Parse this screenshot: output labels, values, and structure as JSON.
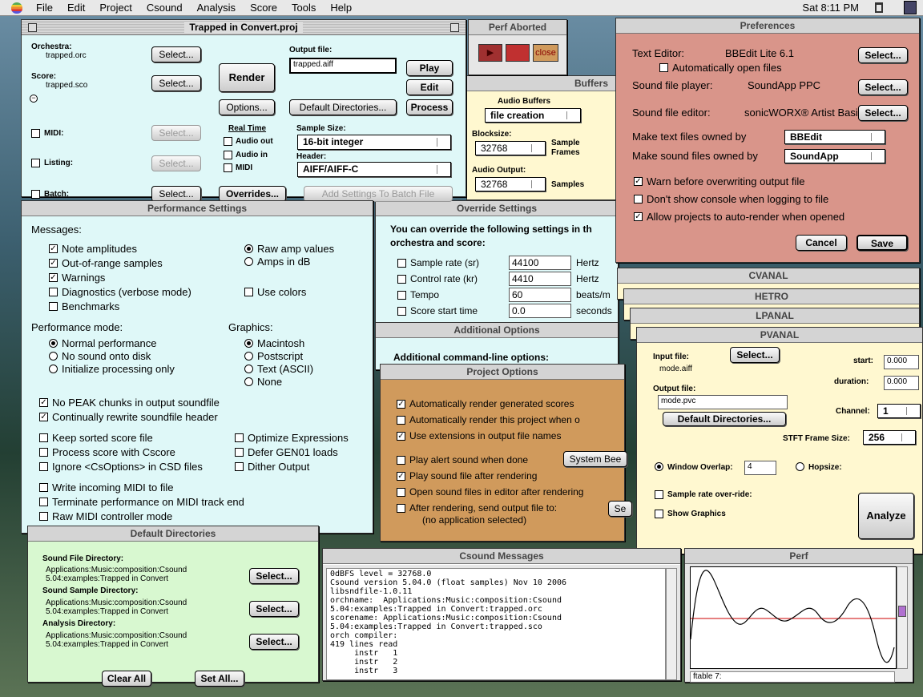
{
  "menubar": {
    "items": [
      "File",
      "Edit",
      "Project",
      "Csound",
      "Analysis",
      "Score",
      "Tools",
      "Help"
    ],
    "clock": "Sat 8:11 PM"
  },
  "project": {
    "title": "Trapped in Convert.proj",
    "orchestra_label": "Orchestra:",
    "orchestra_file": "trapped.orc",
    "score_label": "Score:",
    "score_file": "trapped.sco",
    "select": "Select...",
    "render": "Render",
    "options": "Options...",
    "output_label": "Output file:",
    "output_value": "trapped.aiff",
    "play": "Play",
    "edit": "Edit",
    "default_dirs": "Default Directories...",
    "process": "Process",
    "midi": "MIDI:",
    "listing": "Listing:",
    "batch": "Batch:",
    "real_time": "Real Time",
    "audio_out": "Audio out",
    "audio_in": "Audio in",
    "rt_midi": "MIDI",
    "sample_size_label": "Sample Size:",
    "sample_size": "16-bit integer",
    "header_label": "Header:",
    "header": "AIFF/AIFF-C",
    "overrides": "Overrides...",
    "add_batch": "Add Settings To Batch File"
  },
  "perf_aborted": {
    "title": "Perf Aborted",
    "close": "close"
  },
  "buffers": {
    "title": "Buffers",
    "audio_buffers": "Audio Buffers",
    "mode": "file creation",
    "blocksize_label": "Blocksize:",
    "blocksize": "32768",
    "sample_frames": "Sample Frames",
    "audio_output_label": "Audio Output:",
    "audio_output": "32768",
    "samples": "Samples"
  },
  "prefs": {
    "title": "Preferences",
    "text_editor_label": "Text Editor:",
    "text_editor": "BBEdit Lite 6.1",
    "auto_open": "Automatically open files",
    "player_label": "Sound file player:",
    "player": "SoundApp PPC",
    "sfeditor_label": "Sound file editor:",
    "sfeditor": "sonicWORX® Artist Basic",
    "select": "Select...",
    "text_owned_label": "Make text files owned by",
    "text_owned": "BBEdit",
    "sound_owned_label": "Make sound files owned by",
    "sound_owned": "SoundApp",
    "warn": "Warn before overwriting output file",
    "no_console": "Don't show console when logging to file",
    "auto_render": "Allow projects to auto-render when opened",
    "cancel": "Cancel",
    "save": "Save"
  },
  "perfset": {
    "title": "Performance Settings",
    "messages": "Messages:",
    "note_amps": "Note amplitudes",
    "out_of_range": "Out-of-range samples",
    "warnings": "Warnings",
    "diagnostics": "Diagnostics (verbose mode)",
    "benchmarks": "Benchmarks",
    "raw_amp": "Raw amp values",
    "amps_db": "Amps in dB",
    "use_colors": "Use colors",
    "perf_mode": "Performance mode:",
    "normal": "Normal performance",
    "no_sound": "No sound onto disk",
    "init_only": "Initialize processing only",
    "graphics": "Graphics:",
    "macintosh": "Macintosh",
    "postscript": "Postscript",
    "text_ascii": "Text (ASCII)",
    "none": "None",
    "no_peak": "No PEAK chunks in output soundfile",
    "rewrite_header": "Continually rewrite soundfile header",
    "keep_sorted": "Keep sorted score file",
    "process_cscore": "Process score with Cscore",
    "ignore_csoptions": "Ignore <CsOptions> in CSD files",
    "optimize": "Optimize Expressions",
    "defer_gen01": "Defer GEN01 loads",
    "dither": "Dither Output",
    "write_midi": "Write incoming MIDI to file",
    "terminate_midi": "Terminate performance on MIDI track end",
    "raw_midi": "Raw MIDI controller mode"
  },
  "override": {
    "title": "Override Settings",
    "intro1": "You can override the following settings in th",
    "intro2": "orchestra and score:",
    "rows": [
      {
        "label": "Sample rate (sr)",
        "value": "44100",
        "unit": "Hertz"
      },
      {
        "label": "Control rate (kr)",
        "value": "4410",
        "unit": "Hertz"
      },
      {
        "label": "Tempo",
        "value": "60",
        "unit": "beats/m"
      },
      {
        "label": "Score start time",
        "value": "0.0",
        "unit": "seconds"
      }
    ]
  },
  "addopts": {
    "title": "Additional Options",
    "label": "Additional command-line options:"
  },
  "projopts": {
    "title": "Project Options",
    "auto_gen": "Automatically render generated scores",
    "auto_this": "Automatically render this project when o",
    "use_ext": "Use extensions in output file names",
    "alert": "Play alert sound when done",
    "system_beep": "System Bee",
    "play_after": "Play sound file after rendering",
    "open_editor": "Open sound files in editor after rendering",
    "send_to": "After rendering, send output file to:",
    "send_btn": "Se",
    "no_app": "(no application selected)"
  },
  "cvanal": {
    "title": "CVANAL"
  },
  "hetro": {
    "title": "HETRO"
  },
  "lpanal": {
    "title": "LPANAL"
  },
  "pvanal": {
    "title": "PVANAL",
    "input_label": "Input file:",
    "select": "Select...",
    "input_file": "mode.aiff",
    "start_label": "start:",
    "start": "0.000",
    "duration_label": "duration:",
    "duration": "0.000",
    "output_label": "Output file:",
    "output": "mode.pvc",
    "default_dirs": "Default Directories...",
    "channel_label": "Channel:",
    "channel": "1",
    "stft_label": "STFT Frame Size:",
    "stft": "256",
    "window_overlap": "Window Overlap:",
    "overlap": "4",
    "hopsize": "Hopsize:",
    "srate_override": "Sample rate over-ride:",
    "show_graphics": "Show Graphics",
    "analyze": "Analyze"
  },
  "defdirs": {
    "title": "Default Directories",
    "sound_label": "Sound File Directory:",
    "sound_path1": "Applications:Music:composition:Csound",
    "sound_path2": "5.04:examples:Trapped in Convert",
    "sample_label": "Sound Sample Directory:",
    "sample_path1": "Applications:Music:composition:Csound",
    "sample_path2": "5.04:examples:Trapped in Convert",
    "analysis_label": "Analysis Directory:",
    "analysis_path1": "Applications:Music:composition:Csound",
    "analysis_path2": "5.04:examples:Trapped in Convert",
    "select": "Select...",
    "clear_all": "Clear All",
    "set_all": "Set All..."
  },
  "messages": {
    "title": "Csound Messages",
    "text": "0dBFS level = 32768.0\nCsound version 5.04.0 (float samples) Nov 10 2006\nlibsndfile-1.0.11\norchname:  Applications:Music:composition:Csound\n5.04:examples:Trapped in Convert:trapped.orc\nscorename: Applications:Music:composition:Csound\n5.04:examples:Trapped in Convert:trapped.sco\norch compiler:\n419 lines read\n     instr   1\n     instr   2\n     instr   3"
  },
  "perf": {
    "title": "Perf",
    "caption": "ftable 7:"
  },
  "colors": {
    "cyan": "#dff8f8",
    "yellow": "#fff8d0",
    "salmon": "#d9958a",
    "green": "#d8f8d0",
    "orange": "#d09a5c"
  }
}
